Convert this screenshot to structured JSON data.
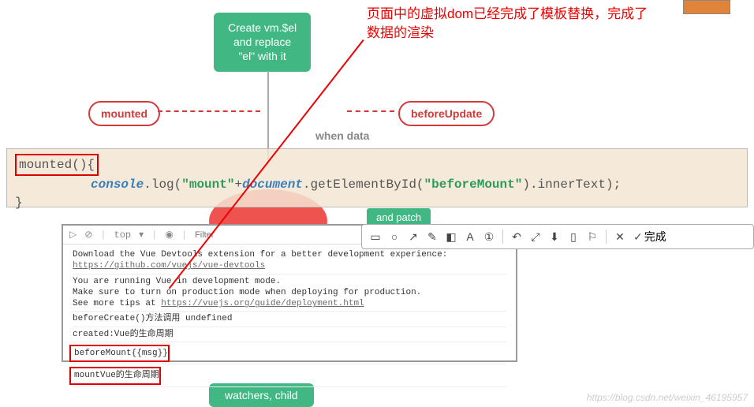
{
  "diagram": {
    "create_node": "Create vm.$el\nand replace\n\"el\" with it",
    "mounted_label": "mounted",
    "beforeupdate_label": "beforeUpdate",
    "when_data": "when data",
    "and_patch": "and patch",
    "watchers": "watchers, child"
  },
  "annotation": {
    "line1": "页面中的虚拟dom已经完成了模板替换，完成了",
    "line2": "数据的渲染"
  },
  "code": {
    "mounted_decl": "mounted(){",
    "console": "console",
    "dot_log_open": ".log(",
    "str_mount": "\"mount\"",
    "plus": "+",
    "document": "document",
    "get_el": ".getElementById(",
    "str_before": "\"beforeMount\"",
    "close_inner": ").innerText);",
    "close_brace": "}"
  },
  "toolbar": {
    "done": "完成"
  },
  "console": {
    "top": "top",
    "filter_placeholder": "Filter",
    "msg1_a": "Download the Vue Devtools extension for a better development experience:",
    "msg1_b": "https://github.com/vuejs/vue-devtools",
    "msg2_a": "You are running Vue in development mode.",
    "msg2_b": "Make sure to turn on production mode when deploying for production.",
    "msg2_c": "See more tips at ",
    "msg2_link": "https://vuejs.org/guide/deployment.html",
    "msg3": "beforeCreate()方法调用 undefined",
    "msg4": "created:Vue的生命周期",
    "msg5": "beforeMount{{msg}}",
    "msg6": "mountVue的生命周期"
  },
  "watermark": "https://blog.csdn.net/weixin_46195957"
}
